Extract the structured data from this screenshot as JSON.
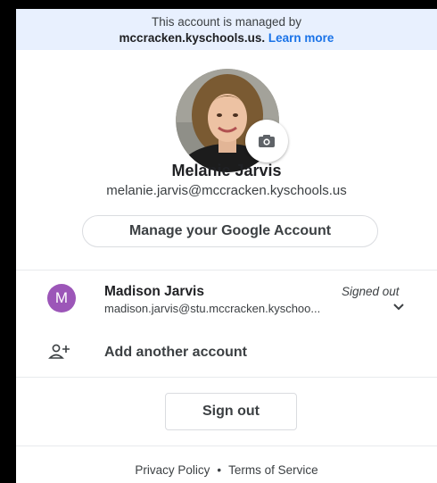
{
  "banner": {
    "line1": "This account is managed by",
    "domain": "mccracken.kyschools.us.",
    "learn_more": "Learn more"
  },
  "profile": {
    "name": "Melanie Jarvis",
    "email": "melanie.jarvis@mccracken.kyschools.us",
    "avatar": "profile-photo",
    "camera_icon": "camera-icon"
  },
  "manage_button": "Manage your Google Account",
  "other_account": {
    "initial": "M",
    "name": "Madison Jarvis",
    "email": "madison.jarvis@stu.mccracken.kyschoo...",
    "status": "Signed out",
    "avatar_color": "#9c56b8",
    "expand_icon": "chevron-down-icon"
  },
  "add_account": {
    "label": "Add another account",
    "icon": "person-add-icon"
  },
  "sign_out": "Sign out",
  "footer": {
    "privacy": "Privacy Policy",
    "separator": "•",
    "terms": "Terms of Service"
  },
  "colors": {
    "banner_bg": "#e8f0fe",
    "link": "#1a73e8",
    "divider": "#e8eaed"
  }
}
